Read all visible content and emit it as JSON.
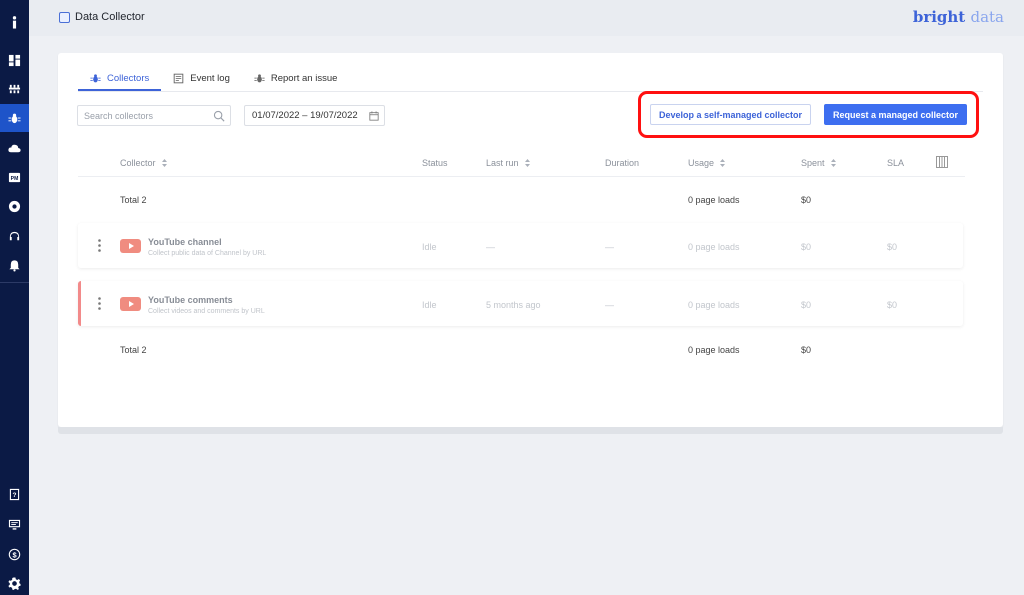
{
  "sidebar": {
    "items": [
      {
        "name": "info-icon"
      },
      {
        "name": "dashboard-icon"
      },
      {
        "name": "proxies-icon"
      },
      {
        "name": "collector-bug-icon",
        "active": true
      },
      {
        "name": "api-cloud-icon",
        "label": "API"
      },
      {
        "name": "pm-icon",
        "label": "PM"
      },
      {
        "name": "chrome-icon"
      },
      {
        "name": "support-headset-icon"
      },
      {
        "name": "notifications-bell-icon"
      }
    ],
    "bottom_items": [
      {
        "name": "help-doc-icon"
      },
      {
        "name": "billing-screen-icon"
      },
      {
        "name": "billing-dollar-icon",
        "label": "$"
      },
      {
        "name": "settings-gear-icon"
      }
    ]
  },
  "header": {
    "app_title": "Data Collector",
    "brand_main": "bright",
    "brand_sub": "data"
  },
  "tabs": [
    {
      "label": "Collectors",
      "active": true,
      "icon": "bug-icon"
    },
    {
      "label": "Event log",
      "icon": "log-icon"
    },
    {
      "label": "Report an issue",
      "icon": "report-bug-icon"
    }
  ],
  "search": {
    "placeholder": "Search collectors",
    "value": ""
  },
  "date_range": "01/07/2022 – 19/07/2022",
  "buttons": {
    "develop": "Develop a self-managed collector",
    "request": "Request a managed collector"
  },
  "table": {
    "columns": [
      "Collector",
      "Status",
      "Last run",
      "Duration",
      "Usage",
      "Spent",
      "SLA"
    ],
    "total_top": {
      "label": "Total 2",
      "usage": "0 page loads",
      "spent": "$0"
    },
    "rows": [
      {
        "name": "YouTube channel",
        "description": "Collect public data of Channel by URL",
        "status": "Idle",
        "last_run": "—",
        "duration": "—",
        "usage": "0 page loads",
        "spent": "$0",
        "sla": "$0"
      },
      {
        "name": "YouTube comments",
        "description": "Collect videos and comments by URL",
        "status": "Idle",
        "last_run": "5 months ago",
        "duration": "—",
        "usage": "0 page loads",
        "spent": "$0",
        "sla": "$0"
      }
    ],
    "total_bottom": {
      "label": "Total 2",
      "usage": "0 page loads",
      "spent": "$0"
    }
  },
  "colors": {
    "sidebar_bg": "#0b1a45",
    "accent": "#3d63d8",
    "primary_button": "#3d6ef0",
    "highlight": "#ff1010"
  }
}
